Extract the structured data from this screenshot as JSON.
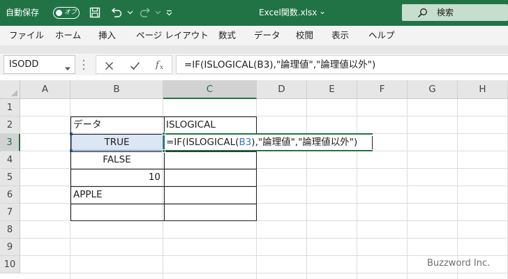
{
  "titlebar": {
    "autosave_label": "自動保存",
    "autosave_state": "オフ",
    "file_name": "Excel関数.xlsx",
    "file_name_caret": "⌄",
    "search_placeholder": "検索",
    "save_icon": "save-icon",
    "undo_icon": "undo-icon",
    "redo_icon": "redo-icon",
    "customize_icon": "customize-qat-icon",
    "background": "#217346"
  },
  "ribbon": {
    "tabs": [
      "ファイル",
      "ホーム",
      "挿入",
      "ページ レイアウト",
      "数式",
      "データ",
      "校閲",
      "表示",
      "ヘルプ"
    ]
  },
  "formula_bar": {
    "name_box": "ISODD",
    "cancel_icon": "✕",
    "enter_icon": "✓",
    "fx_label": "fx",
    "formula": "=IF(ISLOGICAL(B3),\"論理値\",\"論理値以外\")"
  },
  "sheet": {
    "columns": [
      "A",
      "B",
      "C",
      "D",
      "E",
      "F",
      "G",
      "H"
    ],
    "rows": [
      "1",
      "2",
      "3",
      "4",
      "5",
      "6",
      "7",
      "8",
      "9",
      "10"
    ],
    "selected_column": "C",
    "selected_row": "3",
    "cells": {
      "B2": "データ",
      "C2": "ISLOGICAL",
      "B3": "TRUE",
      "B4": "FALSE",
      "B5": "10",
      "B6": "APPLE"
    },
    "editing_cell": {
      "address": "C3",
      "prefix": "=IF(ISLOGICAL(",
      "reference": "B3",
      "suffix": "),\"論理値\",\"論理値以外\")"
    },
    "accent_color": "#217346",
    "reference_color": "#3a78c3"
  },
  "watermark": "Buzzword Inc."
}
